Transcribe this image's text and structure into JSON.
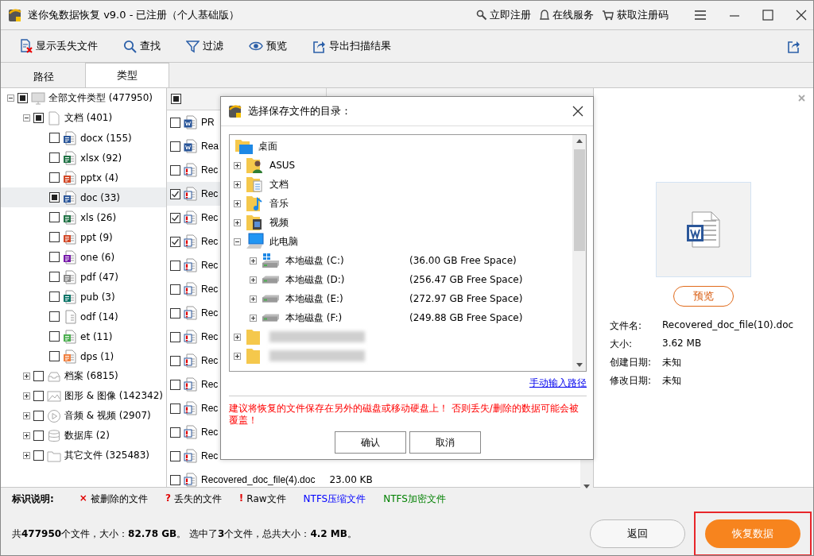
{
  "window": {
    "title": "迷你兔数据恢复 v9.0 - 已注册（个人基础版）",
    "links": [
      {
        "kind": "key",
        "label": "立即注册"
      },
      {
        "kind": "service",
        "label": "在线服务"
      },
      {
        "kind": "cart",
        "label": "获取注册码"
      }
    ]
  },
  "toolbar": [
    {
      "kind": "lost",
      "label": "显示丢失文件"
    },
    {
      "kind": "search",
      "label": "查找"
    },
    {
      "kind": "filter",
      "label": "过滤"
    },
    {
      "kind": "eye",
      "label": "预览"
    },
    {
      "kind": "export",
      "label": "导出扫描结果"
    }
  ],
  "tabs": [
    {
      "label": "路径",
      "selected": false
    },
    {
      "label": "类型",
      "selected": true
    }
  ],
  "tree": {
    "items": [
      {
        "kind": "monitor",
        "label": "全部文件类型 (477950)",
        "partial": true,
        "expanded": true,
        "selected": false,
        "children": [
          {
            "kind": "doc",
            "label": "文档 (401)",
            "partial": true,
            "expanded": true,
            "selected": false,
            "children": [
              {
                "kind": "word",
                "label": "docx (155)",
                "partial": false,
                "selected": false
              },
              {
                "kind": "excel",
                "label": "xlsx (92)",
                "partial": false,
                "selected": false
              },
              {
                "kind": "ppt",
                "label": "pptx (4)",
                "partial": false,
                "selected": false
              },
              {
                "kind": "word",
                "label": "doc (33)",
                "partial": true,
                "selected": true
              },
              {
                "kind": "excel",
                "label": "xls (26)",
                "partial": false,
                "selected": false
              },
              {
                "kind": "ppt",
                "label": "ppt (9)",
                "partial": false,
                "selected": false
              },
              {
                "kind": "onenote",
                "label": "one (6)",
                "partial": false,
                "selected": false
              },
              {
                "kind": "pdf",
                "label": "pdf (47)",
                "partial": false,
                "selected": false
              },
              {
                "kind": "pub",
                "label": "pub (3)",
                "partial": false,
                "selected": false
              },
              {
                "kind": "blank",
                "label": "odf (14)",
                "partial": false,
                "selected": false
              },
              {
                "kind": "et",
                "label": "et (11)",
                "partial": false,
                "selected": false
              },
              {
                "kind": "dps",
                "label": "dps (1)",
                "partial": false,
                "selected": false
              }
            ]
          },
          {
            "kind": "archive",
            "label": "档案 (6815)",
            "partial": false,
            "expanded": false,
            "selected": false
          },
          {
            "kind": "image",
            "label": "图形 & 图像 (142342)",
            "partial": false,
            "expanded": false,
            "selected": false
          },
          {
            "kind": "video",
            "label": "音频 & 视频 (2907)",
            "partial": false,
            "expanded": false,
            "selected": false
          },
          {
            "kind": "database",
            "label": "数据库 (2)",
            "partial": false,
            "expanded": false,
            "selected": false
          },
          {
            "kind": "folder",
            "label": "其它文件 (325483)",
            "partial": false,
            "expanded": false,
            "selected": false
          }
        ]
      }
    ]
  },
  "file_list": {
    "header_partial": true,
    "rows": [
      {
        "kind": "word",
        "name": "PR",
        "checked": false,
        "selected": false
      },
      {
        "kind": "word",
        "name": "Rea",
        "checked": false,
        "selected": false
      },
      {
        "kind": "raw",
        "name": "Rec",
        "checked": false,
        "selected": false
      },
      {
        "kind": "raw",
        "name": "Rec",
        "checked": true,
        "selected": true
      },
      {
        "kind": "raw",
        "name": "Rec",
        "checked": true,
        "selected": false
      },
      {
        "kind": "raw",
        "name": "Rec",
        "checked": true,
        "selected": false
      },
      {
        "kind": "raw",
        "name": "Rec",
        "checked": false,
        "selected": false
      },
      {
        "kind": "raw",
        "name": "Rec",
        "checked": false,
        "selected": false
      },
      {
        "kind": "raw",
        "name": "Rec",
        "checked": false,
        "selected": false
      },
      {
        "kind": "raw",
        "name": "Rec",
        "checked": false,
        "selected": false
      },
      {
        "kind": "raw",
        "name": "Rec",
        "checked": false,
        "selected": false
      },
      {
        "kind": "raw",
        "name": "Rec",
        "checked": false,
        "selected": false
      },
      {
        "kind": "raw",
        "name": "Rec",
        "checked": false,
        "selected": false
      },
      {
        "kind": "raw",
        "name": "Rec",
        "checked": false,
        "selected": false
      },
      {
        "kind": "raw",
        "name": "Rec",
        "checked": false,
        "selected": false
      },
      {
        "kind": "raw",
        "name": "Recovered_doc_file(4).doc",
        "size": "23.00 KB",
        "checked": false,
        "selected": false
      }
    ]
  },
  "preview": {
    "button": "预览",
    "info": [
      {
        "label": "文件名:",
        "value": "Recovered_doc_file(10).doc"
      },
      {
        "label": "大小:",
        "value": "3.62 MB"
      },
      {
        "label": "创建日期:",
        "value": "未知"
      },
      {
        "label": "修改日期:",
        "value": "未知"
      }
    ]
  },
  "legend": {
    "title": "标识说明:",
    "items": [
      {
        "mark": "×",
        "label": "被删除的文件",
        "color": "#e00000"
      },
      {
        "mark": "?",
        "label": "丢失的文件",
        "color": "#e00000"
      },
      {
        "mark": "!",
        "label": "Raw文件",
        "color": "#e00000"
      },
      {
        "label": "NTFS压缩文件",
        "color": "#0000ff"
      },
      {
        "label": "NTFS加密文件",
        "color": "#008000"
      }
    ]
  },
  "status": "共**477950**个文件，大小：**82.78 GB**。 选中了**3**个文件，总共大小：**4.2 MB**。",
  "buttons": [
    {
      "kind": "secondary",
      "label": "返回",
      "highlight": false
    },
    {
      "kind": "primary",
      "label": "恢复数据",
      "highlight": true
    }
  ],
  "dialog": {
    "title": "选择保存文件的目录：",
    "root": {
      "kind": "desktop",
      "label": "桌面"
    },
    "items": [
      {
        "kind": "user",
        "label": "ASUS",
        "expanded": false
      },
      {
        "kind": "docs",
        "label": "文档",
        "expanded": false
      },
      {
        "kind": "music",
        "label": "音乐",
        "expanded": false
      },
      {
        "kind": "video",
        "label": "视频",
        "expanded": false
      },
      {
        "kind": "pc",
        "label": "此电脑",
        "expanded": true,
        "children": [
          {
            "kind": "windrive",
            "label": "本地磁盘 (C:)",
            "free": "(36.00 GB Free Space)"
          },
          {
            "kind": "drive",
            "label": "本地磁盘 (D:)",
            "free": "(256.47 GB Free Space)"
          },
          {
            "kind": "drive",
            "label": "本地磁盘 (E:)",
            "free": "(272.97 GB Free Space)"
          },
          {
            "kind": "drive",
            "label": "本地磁盘 (F:)",
            "free": "(249.88 GB Free Space)"
          }
        ]
      },
      {
        "kind": "blurred",
        "expanded": false
      },
      {
        "kind": "blurred",
        "expanded": false
      }
    ],
    "link": "手动输入路径",
    "warning": "建议将恢复的文件保存在另外的磁盘或移动硬盘上！ 否则丢失/删除的数据可能会被覆盖！",
    "buttons": [
      "确认",
      "取消"
    ]
  }
}
